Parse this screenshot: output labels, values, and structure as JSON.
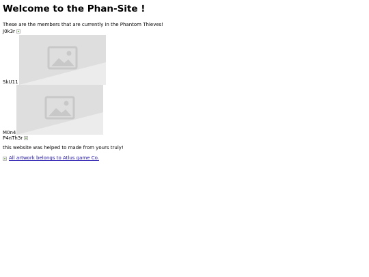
{
  "page": {
    "title": "Welcome to the Phan-Site !",
    "intro": "These are the members that are currently in the Phantom Thieves!",
    "members": [
      {
        "name": "J0k3r",
        "image": "broken-image-icon"
      },
      {
        "name": "SkU11",
        "image": "image-placeholder"
      },
      {
        "name": "M0n4",
        "image": "image-placeholder"
      },
      {
        "name": "P4nTh3r",
        "image": "broken-image-icon"
      }
    ],
    "footer_note": "this website was helped to made from yours truly!",
    "credit_link": "All artwork belongs to Atlus game Co."
  }
}
